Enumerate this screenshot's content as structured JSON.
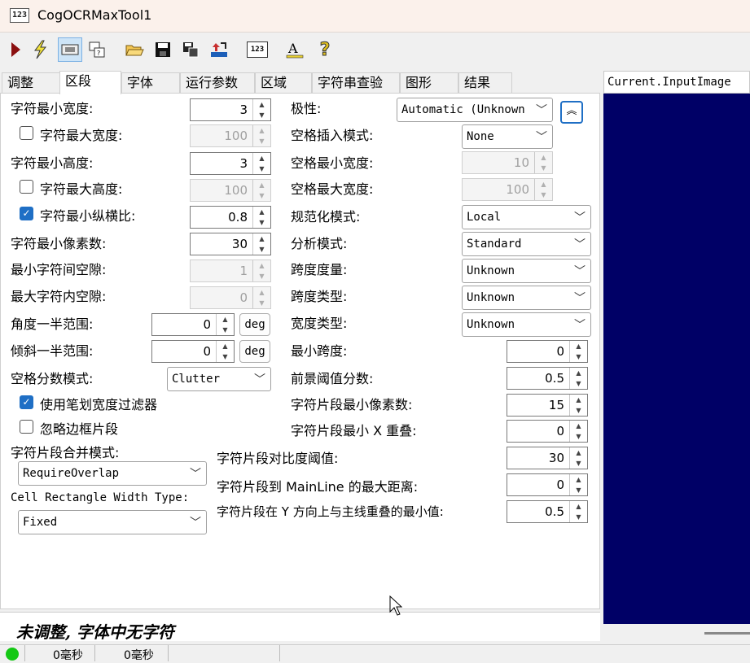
{
  "window": {
    "title": "CogOCRMaxTool1",
    "icon_text": "123"
  },
  "toolbar": {
    "buttons": [
      {
        "name": "run-icon"
      },
      {
        "name": "lightning-icon"
      },
      {
        "name": "image-display-icon"
      },
      {
        "name": "window-help-icon"
      },
      {
        "name": "open-folder-icon"
      },
      {
        "name": "save-icon"
      },
      {
        "name": "save-settings-icon"
      },
      {
        "name": "import-icon"
      },
      {
        "name": "ocr-123-icon",
        "text": "123"
      },
      {
        "name": "train-font-icon"
      },
      {
        "name": "help-question-icon",
        "text": "?"
      }
    ]
  },
  "tabs": [
    {
      "label": "调整"
    },
    {
      "label": "区段"
    },
    {
      "label": "字体"
    },
    {
      "label": "运行参数"
    },
    {
      "label": "区域"
    },
    {
      "label": "字符串查验"
    },
    {
      "label": "图形"
    },
    {
      "label": "结果"
    }
  ],
  "left": {
    "char_min_width": {
      "label": "字符最小宽度:",
      "value": "3"
    },
    "char_max_width": {
      "label": "字符最大宽度:",
      "value": "100",
      "checked": false
    },
    "char_min_height": {
      "label": "字符最小高度:",
      "value": "3"
    },
    "char_max_height": {
      "label": "字符最大高度:",
      "value": "100",
      "checked": false
    },
    "char_min_aspect": {
      "label": "字符最小纵横比:",
      "value": "0.8",
      "checked": true
    },
    "char_min_pixels": {
      "label": "字符最小像素数:",
      "value": "30"
    },
    "min_inter_gap": {
      "label": "最小字符间空隙:",
      "value": "1"
    },
    "max_intra_gap": {
      "label": "最大字符内空隙:",
      "value": "0"
    },
    "angle_half_range": {
      "label": "角度一半范围:",
      "value": "0",
      "unit": "deg"
    },
    "skew_half_range": {
      "label": "倾斜一半范围:",
      "value": "0",
      "unit": "deg"
    },
    "space_score_mode": {
      "label": "空格分数模式:",
      "value": "Clutter"
    },
    "use_stroke_filter": {
      "label": "使用笔划宽度过滤器",
      "checked": true
    },
    "ignore_border": {
      "label": "忽略边框片段",
      "checked": false
    },
    "fragment_merge_mode": {
      "label": "字符片段合并模式:",
      "value": "RequireOverlap"
    },
    "cell_rect_width_type": {
      "label": "Cell Rectangle Width Type:",
      "value": "Fixed"
    }
  },
  "right": {
    "polarity": {
      "label": "极性:",
      "value": "Automatic (Unknown"
    },
    "space_insert_mode": {
      "label": "空格插入模式:",
      "value": "None"
    },
    "space_min_width": {
      "label": "空格最小宽度:",
      "value": "10"
    },
    "space_max_width": {
      "label": "空格最大宽度:",
      "value": "100"
    },
    "normalization_mode": {
      "label": "规范化模式:",
      "value": "Local"
    },
    "analysis_mode": {
      "label": "分析模式:",
      "value": "Standard"
    },
    "pitch_metric": {
      "label": "跨度度量:",
      "value": "Unknown"
    },
    "pitch_type": {
      "label": "跨度类型:",
      "value": "Unknown"
    },
    "width_type": {
      "label": "宽度类型:",
      "value": "Unknown"
    },
    "min_pitch": {
      "label": "最小跨度:",
      "value": "0"
    },
    "fg_threshold_frac": {
      "label": "前景阈值分数:",
      "value": "0.5"
    },
    "frag_min_pixels": {
      "label": "字符片段最小像素数:",
      "value": "15"
    },
    "frag_min_x_overlap": {
      "label": "字符片段最小 X 重叠:",
      "value": "0"
    },
    "frag_contrast_threshold": {
      "label": "字符片段对比度阈值:",
      "value": "30"
    },
    "frag_max_dist_mainline": {
      "label": "字符片段到 MainLine 的最大距离:",
      "value": "0"
    },
    "frag_min_y_overlap": {
      "label": "字符片段在 Y 方向上与主线重叠的最小值:",
      "value": "0.5"
    }
  },
  "status": {
    "message": "未调整, 字体中无字符",
    "time1": "0毫秒",
    "time2": "0毫秒"
  },
  "image_panel": {
    "header": "Current.InputImage",
    "bg": "#000066"
  }
}
